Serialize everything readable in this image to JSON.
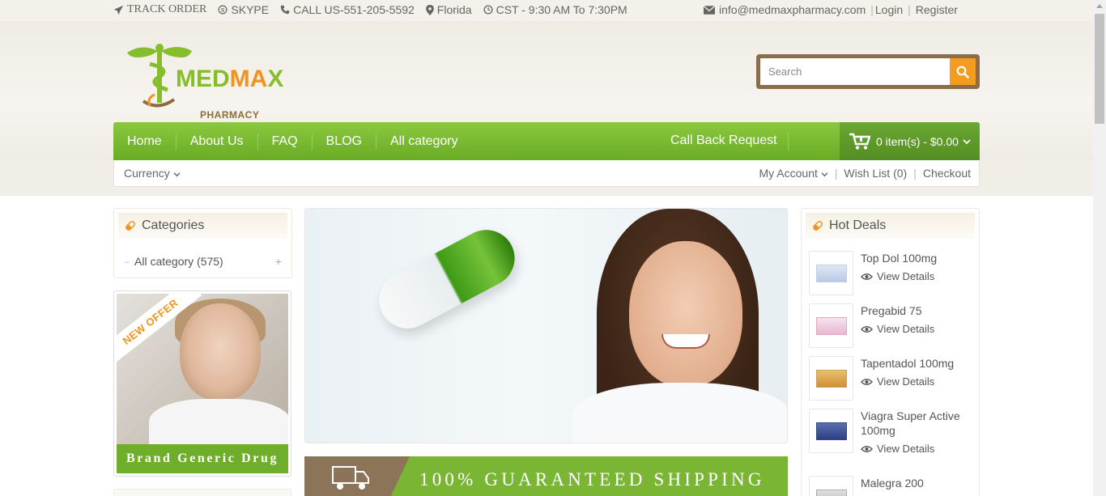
{
  "topbar": {
    "track_order": "TRACK ORDER",
    "skype": "SKYPE",
    "call": "CALL US-551-205-5592",
    "location": "Florida",
    "hours": "CST - 9:30 AM To 7:30PM",
    "email": "info@medmaxpharmacy.com",
    "login": "Login",
    "register": "Register"
  },
  "logo": {
    "brand_green": "MED",
    "brand_orange": "MA",
    "brand_green2": "X",
    "sub": "PHARMACY"
  },
  "search": {
    "placeholder": "Search"
  },
  "nav": {
    "items": [
      "Home",
      "About Us",
      "FAQ",
      "BLOG",
      "All category"
    ],
    "callback": "Call Back Request",
    "cart": "0 item(s) - $0.00"
  },
  "subbar": {
    "currency": "Currency",
    "my_account": "My Account",
    "wishlist": "Wish List (0)",
    "checkout": "Checkout"
  },
  "categories": {
    "title": "Categories",
    "items": [
      {
        "label": "All category (575)"
      }
    ]
  },
  "promo": {
    "ribbon": "NEW OFFER",
    "band": "Brand Generic Drug"
  },
  "shipping": {
    "text": "100% GUARANTEED SHIPPING"
  },
  "hot_deals": {
    "title": "Hot Deals",
    "view_label": "View Details",
    "items": [
      {
        "name": "Top Dol 100mg"
      },
      {
        "name": "Pregabid 75"
      },
      {
        "name": "Tapentadol 100mg"
      },
      {
        "name": "Viagra Super Active 100mg"
      },
      {
        "name": "Malegra 200"
      }
    ]
  },
  "colors": {
    "green": "#7ab634",
    "orange": "#f39c1f",
    "brown": "#8b6d4c"
  },
  "icons": [
    "plane-icon",
    "skype-icon",
    "phone-icon",
    "map-marker-icon",
    "clock-icon",
    "envelope-icon",
    "search-icon",
    "cart-icon",
    "pill-icon",
    "eye-icon",
    "truck-icon"
  ]
}
